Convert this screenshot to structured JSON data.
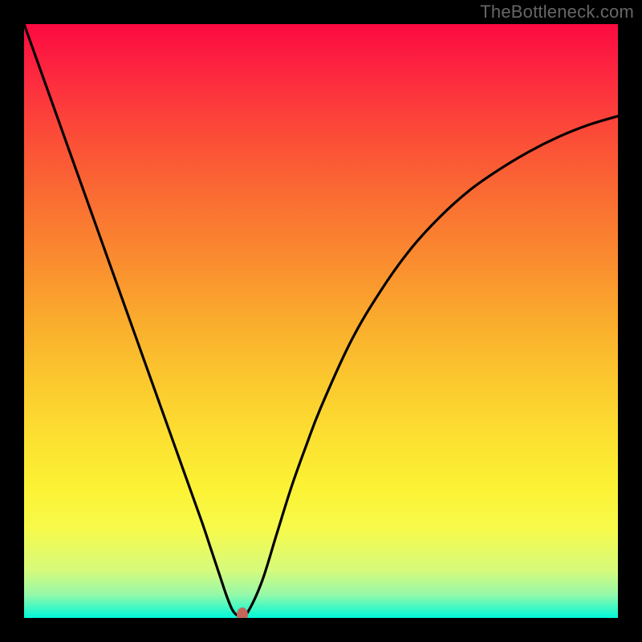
{
  "watermark": "TheBottleneck.com",
  "chart_data": {
    "type": "line",
    "title": "",
    "xlabel": "",
    "ylabel": "",
    "xlim": [
      0,
      100
    ],
    "ylim": [
      0,
      100
    ],
    "grid": false,
    "background_gradient": {
      "direction": "top-to-bottom",
      "stops": [
        {
          "pos": 0.0,
          "color": "#fc0a40"
        },
        {
          "pos": 0.1,
          "color": "#fd2e3f"
        },
        {
          "pos": 0.2,
          "color": "#fb5037"
        },
        {
          "pos": 0.3,
          "color": "#fa6f32"
        },
        {
          "pos": 0.4,
          "color": "#fa8d2f"
        },
        {
          "pos": 0.5,
          "color": "#faac2d"
        },
        {
          "pos": 0.6,
          "color": "#fbc82e"
        },
        {
          "pos": 0.7,
          "color": "#fce131"
        },
        {
          "pos": 0.78,
          "color": "#fcf234"
        },
        {
          "pos": 0.85,
          "color": "#f7fa4b"
        },
        {
          "pos": 0.92,
          "color": "#d6fa7c"
        },
        {
          "pos": 0.96,
          "color": "#97f9a8"
        },
        {
          "pos": 1.0,
          "color": "#00f8d8"
        }
      ]
    },
    "series": [
      {
        "name": "bottleneck-curve",
        "color": "#000000",
        "x": [
          0.0,
          2.5,
          5.0,
          7.5,
          10.0,
          12.5,
          15.0,
          17.5,
          20.0,
          22.5,
          25.0,
          27.5,
          30.0,
          31.5,
          33.0,
          34.0,
          35.0,
          35.8,
          36.5,
          37.5,
          40.0,
          42.5,
          45.0,
          47.5,
          50.0,
          55.0,
          60.0,
          65.0,
          70.0,
          75.0,
          80.0,
          85.0,
          90.0,
          95.0,
          100.0
        ],
        "y": [
          100,
          93.0,
          86.0,
          79.0,
          72.0,
          65.0,
          58.0,
          51.0,
          44.0,
          37.0,
          30.0,
          23.0,
          16.0,
          11.5,
          7.0,
          4.0,
          1.5,
          0.5,
          0.5,
          0.7,
          6.0,
          14.0,
          22.0,
          29.0,
          35.5,
          46.5,
          55.0,
          62.0,
          67.5,
          72.0,
          75.5,
          78.5,
          81.0,
          83.0,
          84.5
        ]
      }
    ],
    "marker": {
      "x": 36.8,
      "y": 0.6,
      "color": "#c5665a"
    },
    "annotations": []
  }
}
